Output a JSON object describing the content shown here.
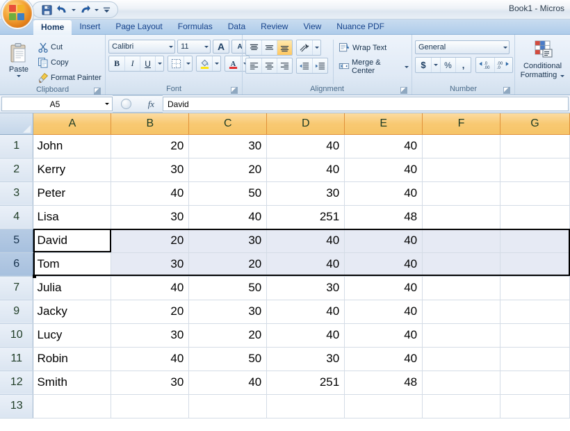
{
  "window": {
    "title": "Book1 - Micros",
    "office_button": "office-orb"
  },
  "quick_access": {
    "items": [
      {
        "name": "save",
        "label": "Save",
        "icon": "save-icon"
      },
      {
        "name": "undo",
        "label": "Undo",
        "icon": "undo-icon"
      },
      {
        "name": "redo",
        "label": "Redo",
        "icon": "redo-icon"
      }
    ],
    "customize_label": "Customize Quick Access Toolbar"
  },
  "ribbon": {
    "tabs": [
      {
        "label": "Home",
        "active": true
      },
      {
        "label": "Insert",
        "active": false
      },
      {
        "label": "Page Layout",
        "active": false
      },
      {
        "label": "Formulas",
        "active": false
      },
      {
        "label": "Data",
        "active": false
      },
      {
        "label": "Review",
        "active": false
      },
      {
        "label": "View",
        "active": false
      },
      {
        "label": "Nuance PDF",
        "active": false
      }
    ],
    "groups": {
      "clipboard": {
        "label": "Clipboard",
        "paste": "Paste",
        "cut": "Cut",
        "copy": "Copy",
        "format_painter": "Format Painter"
      },
      "font": {
        "label": "Font",
        "font_name": "Calibri",
        "font_size": "11",
        "grow_font": "A",
        "shrink_font": "A",
        "bold": "B",
        "italic": "I",
        "underline": "U",
        "border_tip": "Borders",
        "fill_tip": "Fill Color",
        "font_color_tip": "Font Color"
      },
      "alignment": {
        "label": "Alignment",
        "top_align": "Top Align",
        "middle_align": "Middle Align",
        "bottom_align": "Bottom Align",
        "orientation": "Orientation",
        "align_left": "Align Text Left",
        "align_center": "Center",
        "align_right": "Align Text Right",
        "decrease_indent": "Decrease Indent",
        "increase_indent": "Increase Indent",
        "wrap_text": "Wrap Text",
        "merge_center": "Merge & Center"
      },
      "number": {
        "label": "Number",
        "format": "General",
        "accounting": "$",
        "percent": "%",
        "comma": ",",
        "increase_decimal": "Increase Decimal",
        "decrease_decimal": "Decrease Decimal"
      },
      "styles": {
        "conditional_formatting_line1": "Conditional",
        "conditional_formatting_line2": "Formatting"
      }
    }
  },
  "formula_bar": {
    "name_box": "A5",
    "fx_label": "fx",
    "value": "David"
  },
  "sheet": {
    "columns": [
      "A",
      "B",
      "C",
      "D",
      "E",
      "F",
      "G"
    ],
    "rows": [
      {
        "num": "1",
        "selected": false,
        "cells": [
          "John",
          "20",
          "30",
          "40",
          "40",
          "",
          ""
        ]
      },
      {
        "num": "2",
        "selected": false,
        "cells": [
          "Kerry",
          "30",
          "20",
          "40",
          "40",
          "",
          ""
        ]
      },
      {
        "num": "3",
        "selected": false,
        "cells": [
          "Peter",
          "40",
          "50",
          "30",
          "40",
          "",
          ""
        ]
      },
      {
        "num": "4",
        "selected": false,
        "cells": [
          "Lisa",
          "30",
          "40",
          "251",
          "48",
          "",
          ""
        ]
      },
      {
        "num": "5",
        "selected": true,
        "cells": [
          "David",
          "20",
          "30",
          "40",
          "40",
          "",
          ""
        ]
      },
      {
        "num": "6",
        "selected": true,
        "cells": [
          "Tom",
          "30",
          "20",
          "40",
          "40",
          "",
          ""
        ]
      },
      {
        "num": "7",
        "selected": false,
        "cells": [
          "Julia",
          "40",
          "50",
          "30",
          "40",
          "",
          ""
        ]
      },
      {
        "num": "9",
        "selected": false,
        "cells": [
          "Jacky",
          "20",
          "30",
          "40",
          "40",
          "",
          ""
        ]
      },
      {
        "num": "10",
        "selected": false,
        "cells": [
          "Lucy",
          "30",
          "20",
          "40",
          "40",
          "",
          ""
        ]
      },
      {
        "num": "11",
        "selected": false,
        "cells": [
          "Robin",
          "40",
          "50",
          "30",
          "40",
          "",
          ""
        ]
      },
      {
        "num": "12",
        "selected": false,
        "cells": [
          "Smith",
          "30",
          "40",
          "251",
          "48",
          "",
          ""
        ]
      },
      {
        "num": "13",
        "selected": false,
        "cells": [
          "",
          "",
          "",
          "",
          "",
          "",
          ""
        ]
      }
    ],
    "active_cell": "A5",
    "selection_range": "5:6"
  },
  "colors": {
    "accent_orange": "#f6c468",
    "header_blue": "#aeccea",
    "selection_fill": "#e6eaf4",
    "row_header_selected": "#a7c0de",
    "tab_text": "#15428b"
  }
}
